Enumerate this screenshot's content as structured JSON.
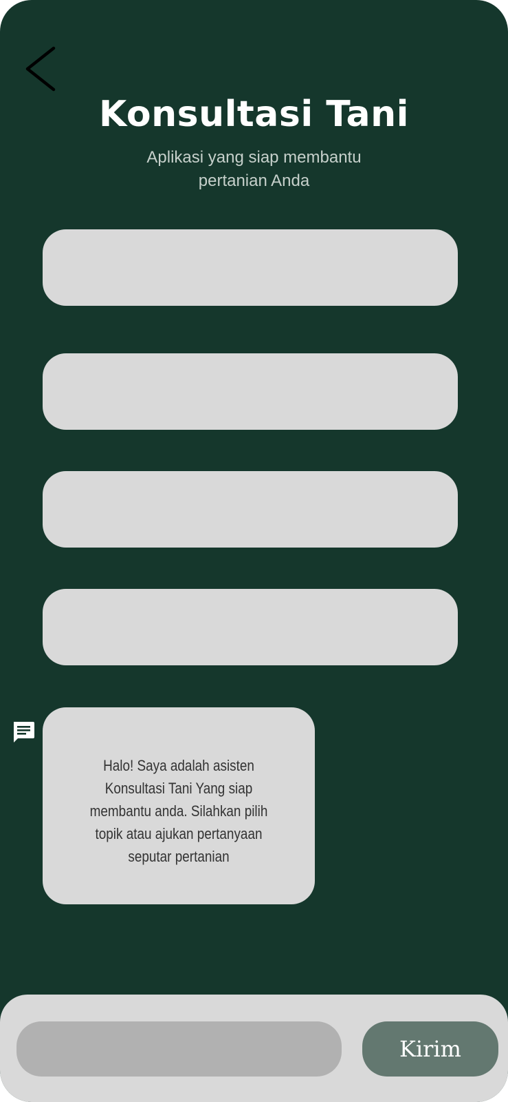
{
  "header": {
    "back_icon": "chevron-left-icon",
    "title": "Konsultasi Tani",
    "subtitle": "Aplikasi yang siap membantu pertanian Anda"
  },
  "topics": [
    {
      "label": ""
    },
    {
      "label": ""
    },
    {
      "label": ""
    },
    {
      "label": ""
    }
  ],
  "chat": {
    "bot_icon": "chat-message-icon",
    "bot_message": "Halo! Saya adalah asisten Konsultasi Tani Yang siap membantu anda. Silahkan pilih topik atau ajukan pertanyaan seputar pertanian"
  },
  "composer": {
    "input_value": "",
    "input_placeholder": "",
    "send_label": "Kirim"
  },
  "colors": {
    "background": "#15372c",
    "card": "#d9d9d9",
    "input": "#b1b1b1",
    "send_button": "#637870"
  }
}
